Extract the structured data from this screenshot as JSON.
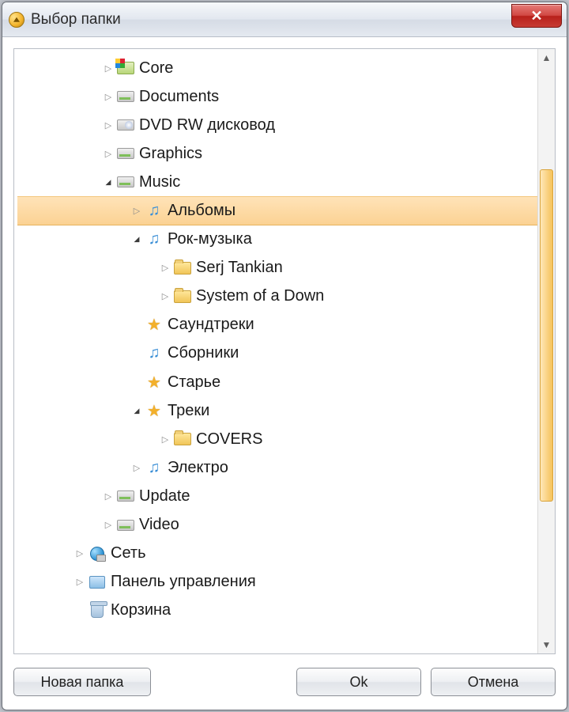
{
  "window": {
    "title": "Выбор папки"
  },
  "buttons": {
    "new_folder": "Новая папка",
    "ok": "Ok",
    "cancel": "Отмена"
  },
  "tree": [
    {
      "label": "Core",
      "depth": 1,
      "expander": "collapsed",
      "icon": "core",
      "selected": false
    },
    {
      "label": "Documents",
      "depth": 1,
      "expander": "collapsed",
      "icon": "drive",
      "selected": false
    },
    {
      "label": "DVD RW дисковод",
      "depth": 1,
      "expander": "collapsed",
      "icon": "dvd",
      "selected": false
    },
    {
      "label": "Graphics",
      "depth": 1,
      "expander": "collapsed",
      "icon": "drive",
      "selected": false
    },
    {
      "label": "Music",
      "depth": 1,
      "expander": "expanded",
      "icon": "drive",
      "selected": false
    },
    {
      "label": "Альбомы",
      "depth": 2,
      "expander": "collapsed",
      "icon": "music",
      "selected": true
    },
    {
      "label": "Рок-музыка",
      "depth": 2,
      "expander": "expanded",
      "icon": "music",
      "selected": false
    },
    {
      "label": "Serj Tankian",
      "depth": 3,
      "expander": "collapsed",
      "icon": "folder",
      "selected": false
    },
    {
      "label": "System of a Down",
      "depth": 3,
      "expander": "collapsed",
      "icon": "folder",
      "selected": false
    },
    {
      "label": "Саундтреки",
      "depth": 2,
      "expander": "none",
      "icon": "star",
      "selected": false
    },
    {
      "label": "Сборники",
      "depth": 2,
      "expander": "none",
      "icon": "music",
      "selected": false
    },
    {
      "label": "Старье",
      "depth": 2,
      "expander": "none",
      "icon": "star",
      "selected": false
    },
    {
      "label": "Треки",
      "depth": 2,
      "expander": "expanded",
      "icon": "star",
      "selected": false
    },
    {
      "label": "COVERS",
      "depth": 3,
      "expander": "collapsed",
      "icon": "folder",
      "selected": false
    },
    {
      "label": "Электро",
      "depth": 2,
      "expander": "collapsed",
      "icon": "music",
      "selected": false
    },
    {
      "label": "Update",
      "depth": 1,
      "expander": "collapsed",
      "icon": "drive",
      "selected": false
    },
    {
      "label": "Video",
      "depth": 1,
      "expander": "collapsed",
      "icon": "drive",
      "selected": false
    },
    {
      "label": "Сеть",
      "depth": 0,
      "expander": "collapsed",
      "icon": "network",
      "selected": false
    },
    {
      "label": "Панель управления",
      "depth": 0,
      "expander": "collapsed",
      "icon": "cpanel",
      "selected": false
    },
    {
      "label": "Корзина",
      "depth": 0,
      "expander": "none",
      "icon": "recycle",
      "selected": false
    }
  ]
}
